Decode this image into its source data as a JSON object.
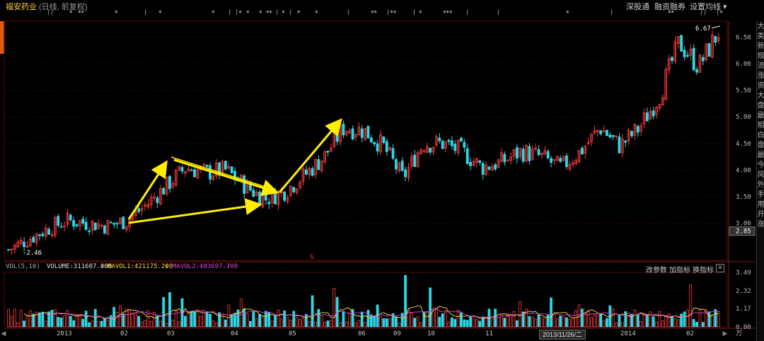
{
  "header": {
    "stock_name": "福安药业",
    "period_label": "(日线, 前复权)",
    "buttons": [
      "深股通",
      "融资融券",
      "设置均线 ▾"
    ]
  },
  "marks_row": [
    {
      "x": 66,
      "t": "ᛛᛛ"
    },
    {
      "x": 98,
      "t": "*"
    },
    {
      "x": 110,
      "t": "**"
    },
    {
      "x": 162,
      "t": "*"
    },
    {
      "x": 203,
      "t": "ᛛ"
    },
    {
      "x": 224,
      "t": "*"
    },
    {
      "x": 299,
      "t": "*"
    },
    {
      "x": 322,
      "t": "ᛛ"
    },
    {
      "x": 332,
      "t": "ᛛ*"
    },
    {
      "x": 348,
      "t": "*"
    },
    {
      "x": 366,
      "t": "*"
    },
    {
      "x": 376,
      "t": "**"
    },
    {
      "x": 389,
      "t": "ᛛ"
    },
    {
      "x": 398,
      "t": "*"
    },
    {
      "x": 408,
      "t": "ᛛ"
    },
    {
      "x": 420,
      "t": "*"
    },
    {
      "x": 445,
      "t": "*"
    },
    {
      "x": 490,
      "t": "ᛛ"
    },
    {
      "x": 524,
      "t": "**"
    },
    {
      "x": 546,
      "t": "ᛛ**"
    },
    {
      "x": 583,
      "t": "ᛛ"
    },
    {
      "x": 592,
      "t": "*"
    },
    {
      "x": 626,
      "t": "***"
    },
    {
      "x": 658,
      "t": "ᛛ"
    },
    {
      "x": 702,
      "t": "ᛛ"
    },
    {
      "x": 800,
      "t": "*"
    },
    {
      "x": 862,
      "t": "ᛛ"
    },
    {
      "x": 944,
      "t": "**"
    },
    {
      "x": 989,
      "t": "ᛛᛛ"
    },
    {
      "x": 1012,
      "t": "ᛛ*"
    }
  ],
  "side_tabs": [
    "大",
    "类",
    "新",
    "规",
    "流",
    "涨",
    "资",
    "大",
    "盘",
    "最",
    "相",
    "白",
    "盘",
    "最",
    "今",
    "风",
    "外",
    "手",
    "用",
    "开",
    "涨"
  ],
  "price_axis": {
    "ticks": [
      "6.50",
      "6.00",
      "5.50",
      "5.00",
      "4.50",
      "4.00",
      "3.50",
      "3.00",
      "2.85"
    ],
    "current": "2.85",
    "high_label": "6.67",
    "low_label": "2.46",
    "event_marker": "S"
  },
  "volume": {
    "indicator": "VOL(5,10)",
    "volume_label": "VOLUME:311607.000",
    "mavol1_label": "MAVOL1:421175.200",
    "mavol2_label": "MAVOL2:483697.700",
    "buttons": [
      "改参数",
      "加指标",
      "换指标"
    ],
    "close": "✕",
    "axis_ticks": [
      "3.49",
      "2.32",
      "1.17",
      "0.00"
    ],
    "unit": "万"
  },
  "time_axis": {
    "labels": [
      "2013",
      "02",
      "03",
      "04",
      "05",
      "06",
      "09",
      "10",
      "11",
      "2014",
      "02"
    ],
    "cursor_date": "2013/11/26/二"
  },
  "colors": {
    "up": "#ff3b3b",
    "down": "#2bd9e6",
    "arrow": "#ffee00",
    "ma1": "#f2e04a",
    "ma2": "#e040e0"
  },
  "chart_data": {
    "type": "candlestick",
    "title": "福安药业",
    "period": "日线, 前复权",
    "ylim": [
      2.3,
      6.8
    ],
    "y_ticks": [
      3.0,
      3.5,
      4.0,
      4.5,
      5.0,
      5.5,
      6.0,
      6.5
    ],
    "high": 6.67,
    "low": 2.46,
    "current_price": 2.85,
    "close_path": [
      {
        "date": "2013-01",
        "close": 2.5
      },
      {
        "date": "2013-01",
        "close": 2.7
      },
      {
        "date": "2013-01",
        "close": 2.9
      },
      {
        "date": "2013-02",
        "close": 3.05
      },
      {
        "date": "2013-02",
        "close": 3.0
      },
      {
        "date": "2013-02",
        "close": 2.95
      },
      {
        "date": "2013-02",
        "close": 3.05
      },
      {
        "date": "2013-03",
        "close": 3.35
      },
      {
        "date": "2013-03",
        "close": 3.7
      },
      {
        "date": "2013-03",
        "close": 4.05
      },
      {
        "date": "2013-04",
        "close": 3.95
      },
      {
        "date": "2013-04",
        "close": 4.0
      },
      {
        "date": "2013-04",
        "close": 3.7
      },
      {
        "date": "2013-04",
        "close": 3.45
      },
      {
        "date": "2013-05",
        "close": 3.6
      },
      {
        "date": "2013-05",
        "close": 3.9
      },
      {
        "date": "2013-05",
        "close": 4.25
      },
      {
        "date": "2013-06",
        "close": 4.8
      },
      {
        "date": "2013-06",
        "close": 4.75
      },
      {
        "date": "2013-07",
        "close": 4.45
      },
      {
        "date": "2013-09",
        "close": 3.85
      },
      {
        "date": "2013-09",
        "close": 4.5
      },
      {
        "date": "2013-10",
        "close": 4.5
      },
      {
        "date": "2013-10",
        "close": 4.35
      },
      {
        "date": "2013-11",
        "close": 4.05
      },
      {
        "date": "2013-11",
        "close": 4.15
      },
      {
        "date": "2013-12",
        "close": 4.35
      },
      {
        "date": "2013-12",
        "close": 4.25
      },
      {
        "date": "2014-01",
        "close": 4.05
      },
      {
        "date": "2014-01",
        "close": 4.35
      },
      {
        "date": "2014-01",
        "close": 4.8
      },
      {
        "date": "2014-01",
        "close": 4.45
      },
      {
        "date": "2014-02",
        "close": 4.8
      },
      {
        "date": "2014-02",
        "close": 5.4
      },
      {
        "date": "2014-02",
        "close": 6.4
      },
      {
        "date": "2014-03",
        "close": 5.95
      },
      {
        "date": "2014-03",
        "close": 6.6
      }
    ],
    "annotations": [
      "yellow arrows drawn by user marking triangle consolidation and breakout"
    ],
    "volume_ylim": [
      0,
      3.49
    ]
  }
}
